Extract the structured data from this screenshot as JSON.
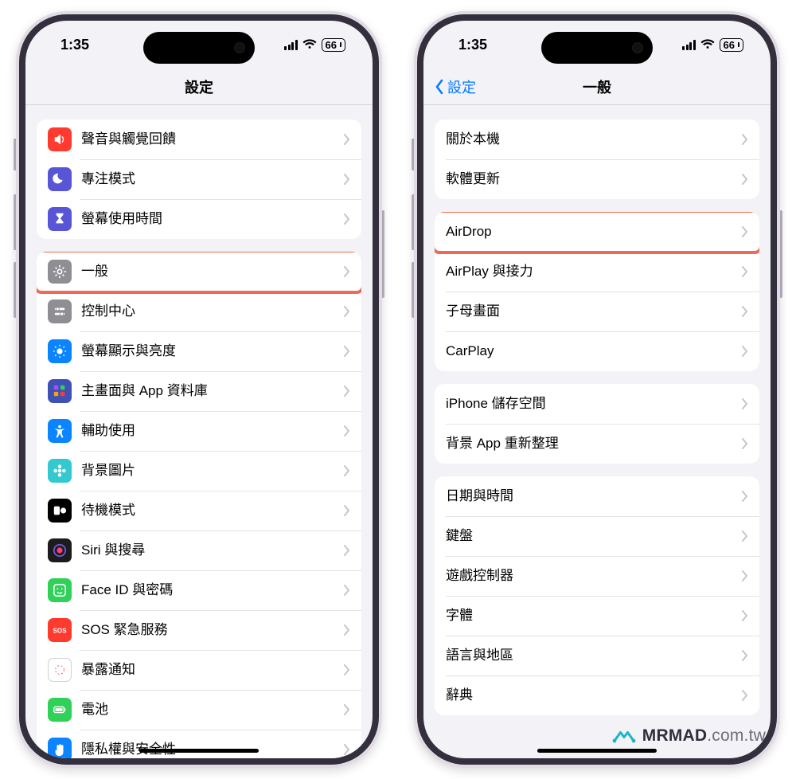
{
  "status": {
    "time": "1:35",
    "battery": "66"
  },
  "left": {
    "title": "設定",
    "groups": [
      [
        {
          "key": "sounds",
          "label": "聲音與觸覺回饋",
          "iconBg": "#ff3b30",
          "icon": "speaker"
        },
        {
          "key": "focus",
          "label": "專注模式",
          "iconBg": "#5856d6",
          "icon": "moon"
        },
        {
          "key": "screentime",
          "label": "螢幕使用時間",
          "iconBg": "#5856d6",
          "icon": "hourglass"
        }
      ],
      [
        {
          "key": "general",
          "label": "一般",
          "iconBg": "#8e8e93",
          "icon": "gear",
          "highlighted": true
        },
        {
          "key": "control",
          "label": "控制中心",
          "iconBg": "#8e8e93",
          "icon": "sliders"
        },
        {
          "key": "display",
          "label": "螢幕顯示與亮度",
          "iconBg": "#0a84ff",
          "icon": "sun"
        },
        {
          "key": "home",
          "label": "主畫面與 App 資料庫",
          "iconBg": "#4051b5",
          "icon": "grid"
        },
        {
          "key": "access",
          "label": "輔助使用",
          "iconBg": "#0a84ff",
          "icon": "accessibility"
        },
        {
          "key": "wallpaper",
          "label": "背景圖片",
          "iconBg": "#34c8d1",
          "icon": "flower"
        },
        {
          "key": "standby",
          "label": "待機模式",
          "iconBg": "#000000",
          "icon": "standby"
        },
        {
          "key": "siri",
          "label": "Siri 與搜尋",
          "iconBg": "#1c1c1e",
          "icon": "siri"
        },
        {
          "key": "faceid",
          "label": "Face ID 與密碼",
          "iconBg": "#30d158",
          "icon": "faceid"
        },
        {
          "key": "sos",
          "label": "SOS 緊急服務",
          "iconBg": "#ff3b30",
          "icon": "sos"
        },
        {
          "key": "exposure",
          "label": "暴露通知",
          "iconBg": "#ffffff",
          "icon": "exposure",
          "iconFg": "#ff3b30"
        },
        {
          "key": "battery",
          "label": "電池",
          "iconBg": "#30d158",
          "icon": "battery"
        },
        {
          "key": "privacy",
          "label": "隱私權與安全性",
          "iconBg": "#0a84ff",
          "icon": "hand"
        }
      ]
    ]
  },
  "right": {
    "back": "設定",
    "title": "一般",
    "groups": [
      [
        {
          "key": "about",
          "label": "關於本機"
        },
        {
          "key": "update",
          "label": "軟體更新"
        }
      ],
      [
        {
          "key": "airdrop",
          "label": "AirDrop",
          "highlighted": true
        },
        {
          "key": "airplay",
          "label": "AirPlay 與接力"
        },
        {
          "key": "pip",
          "label": "子母畫面"
        },
        {
          "key": "carplay",
          "label": "CarPlay"
        }
      ],
      [
        {
          "key": "storage",
          "label": "iPhone 儲存空間"
        },
        {
          "key": "bgapp",
          "label": "背景 App 重新整理"
        }
      ],
      [
        {
          "key": "datetime",
          "label": "日期與時間"
        },
        {
          "key": "keyboard",
          "label": "鍵盤"
        },
        {
          "key": "gamectrl",
          "label": "遊戲控制器"
        },
        {
          "key": "fonts",
          "label": "字體"
        },
        {
          "key": "lang",
          "label": "語言與地區"
        },
        {
          "key": "dict",
          "label": "辭典"
        }
      ]
    ]
  },
  "watermark": {
    "brand": "MRMAD",
    "suffix": ".com.tw"
  }
}
